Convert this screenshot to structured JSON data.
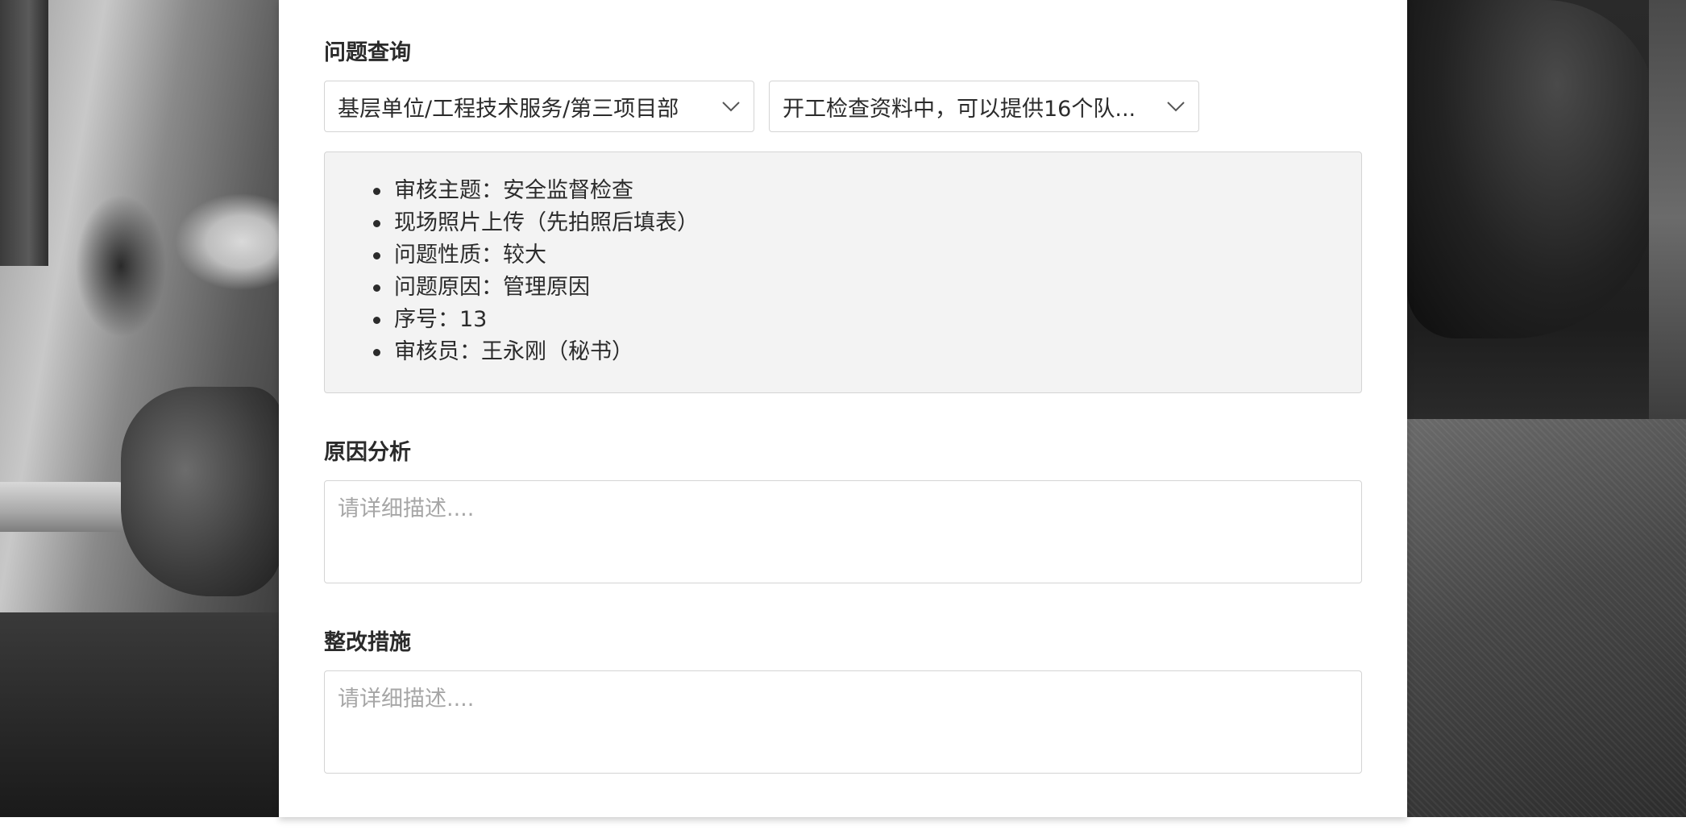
{
  "query_section": {
    "title": "问题查询",
    "unit_select": {
      "value": "基层单位/工程技术服务/第三项目部"
    },
    "issue_select": {
      "value": "开工检查资料中，可以提供16个队..."
    },
    "details": [
      "审核主题：安全监督检查",
      "现场照片上传（先拍照后填表）",
      "问题性质：较大",
      "问题原因：管理原因",
      "序号：13",
      "审核员：王永刚（秘书）"
    ]
  },
  "cause_section": {
    "title": "原因分析",
    "placeholder": "请详细描述...."
  },
  "measures_section": {
    "title": "整改措施",
    "placeholder": "请详细描述...."
  },
  "icons": {
    "select_arrow": "chevron-down-icon"
  },
  "colors": {
    "text": "#2b2b2b",
    "border": "#d4d4d4",
    "info_background": "#f3f3f3",
    "placeholder": "#a6a6a6"
  }
}
